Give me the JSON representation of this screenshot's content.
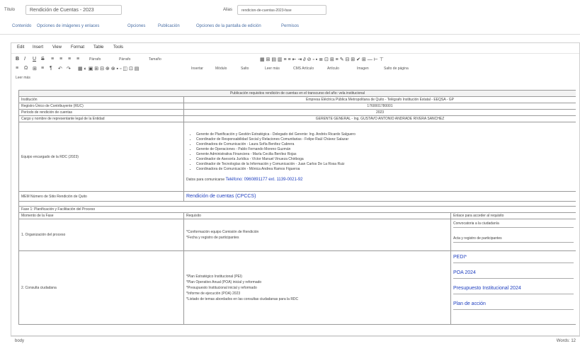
{
  "form": {
    "title_label": "Título",
    "title_value": "Rendición de Cuentas - 2023",
    "alias_label": "Alias",
    "alias_value": "rendicion-de-cuentas-2023-fase"
  },
  "tabs": [
    "Contenido",
    "Opciones de imágenes y enlaces",
    "Opciones",
    "Publicación",
    "Opciones de la pantalla de edición",
    "Permisos"
  ],
  "menubar": [
    "Edit",
    "Insert",
    "View",
    "Format",
    "Table",
    "Tools"
  ],
  "toolbar": {
    "row1_glyphs": [
      "B",
      "I",
      "U",
      "S",
      "≡",
      "≡",
      "≡",
      "≡"
    ],
    "paragraph": "Párrafo",
    "font_family": "Párrafo",
    "font_size": "Tamaño",
    "row2_glyphs": [
      "≡",
      "Ω",
      "⊞",
      "≡",
      "¶",
      "↶",
      "↷"
    ],
    "row2_buttons": [
      "Insertar",
      "Módulo",
      "Salto",
      "Leer más",
      "CMS Artículo",
      "Artículo",
      "Imagen",
      "Salto de página"
    ],
    "row3": [
      "Leer más"
    ]
  },
  "doc": {
    "title_row": "Publicación requisitos rendición de cuentas en el transcurso del año: vela institucional",
    "rows": [
      {
        "label": "Institución",
        "value": "Empresa Eléctrica Pública Metropolitana de Quito - Telégrafo Institución Estatal - EEQSA - GP"
      },
      {
        "label": "Registro Único de Contribuyente (RUC)",
        "value": "1760001780001"
      },
      {
        "label": "Período de rendición de cuentas",
        "value": "2023"
      },
      {
        "label": "Cargo y nombre de representante legal de la Entidad",
        "value": "GERENTE GENERAL - Ing. GUSTAVO ANTONIO ANDRADE RIVERA SANCHEZ"
      }
    ],
    "team_label": "Equipo encargado de la RDC (2023)",
    "team": [
      "Gerente de Planificación y Gestión Estratégica - Delegado del Gerente: Ing. Andrés Ricardo Salguero",
      "Coordinador de Responsabilidad Social y Relaciones Comunitarias - Felipe Raúl Chávez Salazar",
      "Coordinadora de Comunicación - Laura Sofía Benítez Cabrera",
      "Gerente de Operaciones - Pablo Fernando Moreno Guzmán",
      "Gerente Administrativa Financiera - María Cecilia Benítez Rojas",
      "Coordinador de Asesoría Jurídica - Víctor Manuel Vinueza Chiriboga",
      "Coordinador de Tecnologías de la Información y Comunicación - Juan Carlos De La Rosa Ruiz",
      "Coordinadora de Comunicación - Mónica Andrea Ramos Figueroa"
    ],
    "contact_label": "Datos para comunicarse",
    "contact_value": "Teléfono: 0960891177 ext. 1139-0021-92",
    "link_row_label": "MEM Número de Sitio Rendición de Quito",
    "link_row_value": "Rendición de cuentas (CPCCS)",
    "phase_row": "Fase 1: Planificación y Facilitación del Proceso",
    "headers": [
      "Momento de la Fase",
      "Requisito",
      "Enlace para acceder al requisito"
    ],
    "phase_rows": [
      {
        "moment": "1. Organización del proceso",
        "req": [
          "*Conformación equipo Comisión de Rendición",
          "*Fecha y registro de participantes"
        ],
        "links": [
          "Convocatoria a la ciudadanía",
          "Acta y registro de participantes"
        ]
      },
      {
        "moment": "2. Consulta ciudadana",
        "req": [
          "*Plan Estratégico Institucional (PEI)",
          "*Plan Operativo Anual (POA) inicial y reformado",
          "*Presupuesto Institucional inicial y reformado",
          "*Informe de ejecución (POA) 2023",
          "*Listado de temas abordados en las consultas ciudadanas para la RDC"
        ],
        "links": [
          "PEDI*",
          "POA 2024",
          "Presupuesto Institucional 2024",
          "Plan de acción"
        ]
      }
    ]
  },
  "status": {
    "left": "body",
    "right": "Words: 12"
  }
}
